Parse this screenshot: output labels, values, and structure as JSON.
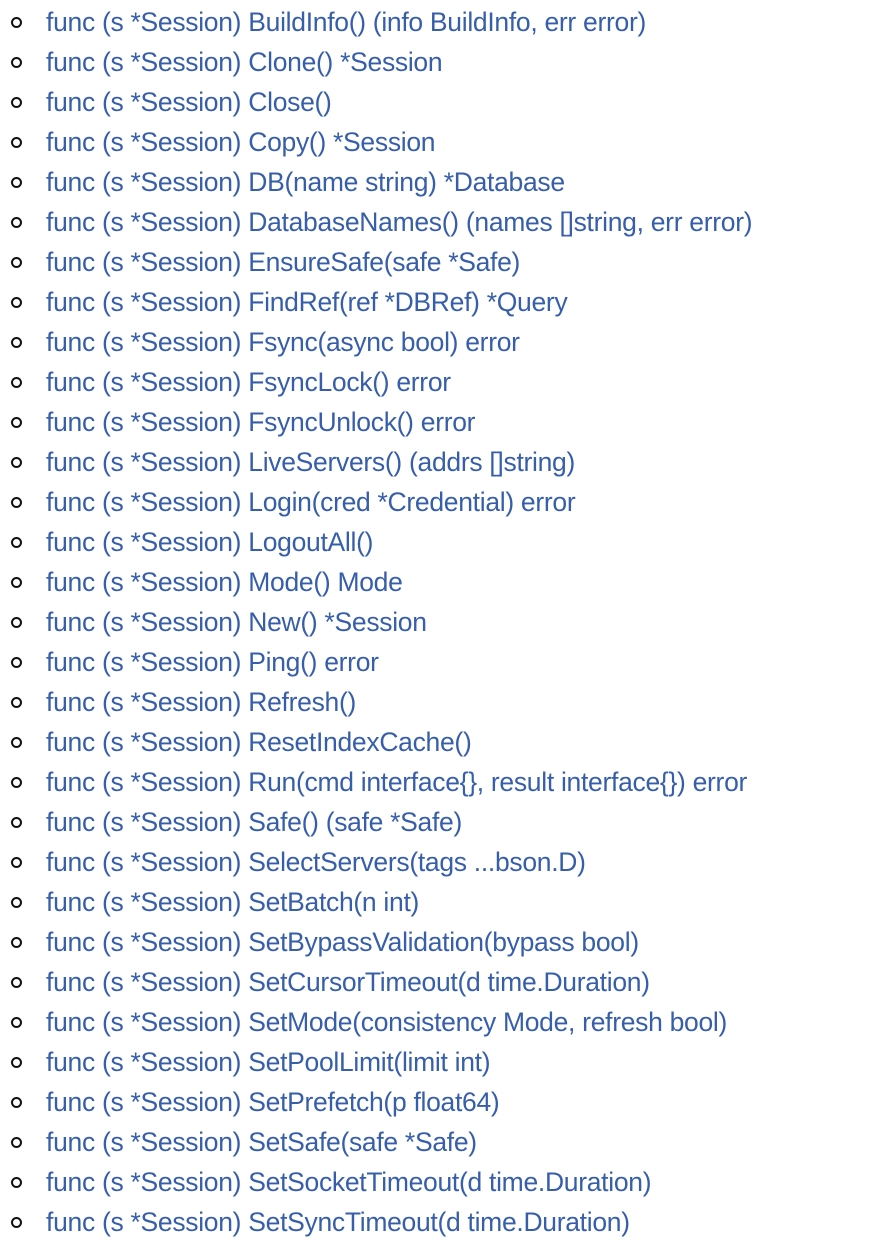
{
  "colors": {
    "link": "#375eab",
    "bullet": "#111111",
    "background": "#ffffff"
  },
  "methods": [
    {
      "label": "func (s *Session) BuildInfo() (info BuildInfo, err error)"
    },
    {
      "label": "func (s *Session) Clone() *Session"
    },
    {
      "label": "func (s *Session) Close()"
    },
    {
      "label": "func (s *Session) Copy() *Session"
    },
    {
      "label": "func (s *Session) DB(name string) *Database"
    },
    {
      "label": "func (s *Session) DatabaseNames() (names []string, err error)"
    },
    {
      "label": "func (s *Session) EnsureSafe(safe *Safe)"
    },
    {
      "label": "func (s *Session) FindRef(ref *DBRef) *Query"
    },
    {
      "label": "func (s *Session) Fsync(async bool) error"
    },
    {
      "label": "func (s *Session) FsyncLock() error"
    },
    {
      "label": "func (s *Session) FsyncUnlock() error"
    },
    {
      "label": "func (s *Session) LiveServers() (addrs []string)"
    },
    {
      "label": "func (s *Session) Login(cred *Credential) error"
    },
    {
      "label": "func (s *Session) LogoutAll()"
    },
    {
      "label": "func (s *Session) Mode() Mode"
    },
    {
      "label": "func (s *Session) New() *Session"
    },
    {
      "label": "func (s *Session) Ping() error"
    },
    {
      "label": "func (s *Session) Refresh()"
    },
    {
      "label": "func (s *Session) ResetIndexCache()"
    },
    {
      "label": "func (s *Session) Run(cmd interface{}, result interface{}) error"
    },
    {
      "label": "func (s *Session) Safe() (safe *Safe)"
    },
    {
      "label": "func (s *Session) SelectServers(tags ...bson.D)"
    },
    {
      "label": "func (s *Session) SetBatch(n int)"
    },
    {
      "label": "func (s *Session) SetBypassValidation(bypass bool)"
    },
    {
      "label": "func (s *Session) SetCursorTimeout(d time.Duration)"
    },
    {
      "label": "func (s *Session) SetMode(consistency Mode, refresh bool)"
    },
    {
      "label": "func (s *Session) SetPoolLimit(limit int)"
    },
    {
      "label": "func (s *Session) SetPrefetch(p float64)"
    },
    {
      "label": "func (s *Session) SetSafe(safe *Safe)"
    },
    {
      "label": "func (s *Session) SetSocketTimeout(d time.Duration)"
    },
    {
      "label": "func (s *Session) SetSyncTimeout(d time.Duration)"
    }
  ]
}
